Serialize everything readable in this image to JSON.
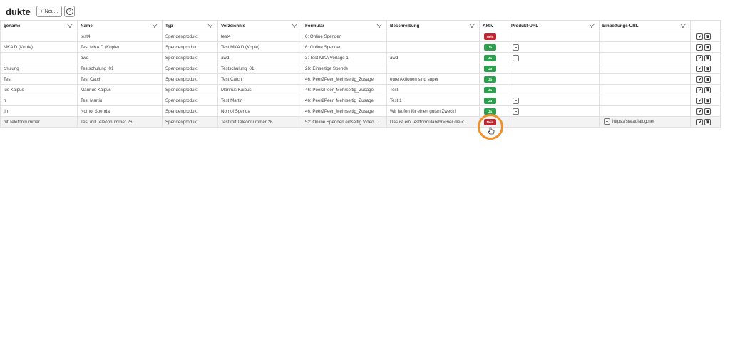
{
  "header": {
    "title": "dukte",
    "new_button": "+ Neu...",
    "help_icon": "help-icon"
  },
  "columns": [
    {
      "label": "gename",
      "filter": true
    },
    {
      "label": "Name",
      "filter": true
    },
    {
      "label": "Typ",
      "filter": true
    },
    {
      "label": "Verzeichnis",
      "filter": true
    },
    {
      "label": "Formular",
      "filter": true
    },
    {
      "label": "Beschreibung",
      "filter": true
    },
    {
      "label": "Aktiv",
      "filter": false
    },
    {
      "label": "Produkt-URL",
      "filter": true
    },
    {
      "label": "Einbettungs-URL",
      "filter": true
    },
    {
      "label": "",
      "filter": false
    }
  ],
  "rows": [
    {
      "c0": "",
      "name": "test4",
      "typ": "Spendenprodukt",
      "verz": "test4",
      "formular": "6: Online Spenden",
      "beschr": "",
      "aktiv": "Nein",
      "aktiv_state": "nein",
      "url_icon": false,
      "embed": ""
    },
    {
      "c0": "MKA D (Kopie)",
      "name": "Test MKA D (Kopie)",
      "typ": "Spendenprodukt",
      "verz": "Test MKA D (Kopie)",
      "formular": "6: Online Spenden",
      "beschr": "",
      "aktiv": "Ja",
      "aktiv_state": "ja",
      "url_icon": true,
      "embed": ""
    },
    {
      "c0": "",
      "name": "awd",
      "typ": "Spendenprodukt",
      "verz": "awd",
      "formular": "3: Test MKA Vorlage 1",
      "beschr": "awd",
      "aktiv": "Ja",
      "aktiv_state": "ja",
      "url_icon": true,
      "embed": ""
    },
    {
      "c0": "chulung",
      "name": "Testschulung_01",
      "typ": "Spendenprodukt",
      "verz": "Testschulung_01",
      "formular": "26: Einseitige Spende",
      "beschr": "",
      "aktiv": "Ja",
      "aktiv_state": "ja",
      "url_icon": false,
      "embed": ""
    },
    {
      "c0": "Test",
      "name": "Test Catch",
      "typ": "Spendenprodukt",
      "verz": "Test Catch",
      "formular": "46: Peer2Peer_Mehrseitig_Zusage",
      "beschr": "eure Aktionen sind super",
      "aktiv": "Ja",
      "aktiv_state": "ja",
      "url_icon": false,
      "embed": ""
    },
    {
      "c0": "ius Kaipus",
      "name": "Marinus Kaipus",
      "typ": "Spendenprodukt",
      "verz": "Marinus Kaipus",
      "formular": "46: Peer2Peer_Mehrseitig_Zusage",
      "beschr": "Test",
      "aktiv": "Ja",
      "aktiv_state": "ja",
      "url_icon": false,
      "embed": ""
    },
    {
      "c0": "n",
      "name": "Test Martin",
      "typ": "Spendenprodukt",
      "verz": "Test Martin",
      "formular": "46: Peer2Peer_Mehrseitig_Zusage",
      "beschr": "Test 1",
      "aktiv": "Ja",
      "aktiv_state": "ja",
      "url_icon": true,
      "embed": ""
    },
    {
      "c0": "lin",
      "name": "Nomoi Spenda",
      "typ": "Spendenprodukt",
      "verz": "Nomoi Spenda",
      "formular": "46: Peer2Peer_Mehrseitig_Zusage",
      "beschr": "Wir laufen für einen guten Zweck!",
      "aktiv": "Ja",
      "aktiv_state": "ja",
      "url_icon": true,
      "embed": ""
    },
    {
      "c0": "nit Telefonnummer",
      "name": "Test mit Teleonnummer 26",
      "typ": "Spendenprodukt",
      "verz": "Test mit Teleonnummer 26",
      "formular": "52: Online Spenden einseitig Video ...",
      "beschr": "Das ist ein Testformular<br>Hier die <...",
      "aktiv": "Nein",
      "aktiv_state": "nein",
      "url_icon": false,
      "embed": "https://statadialog.net",
      "highlighted": true
    }
  ]
}
